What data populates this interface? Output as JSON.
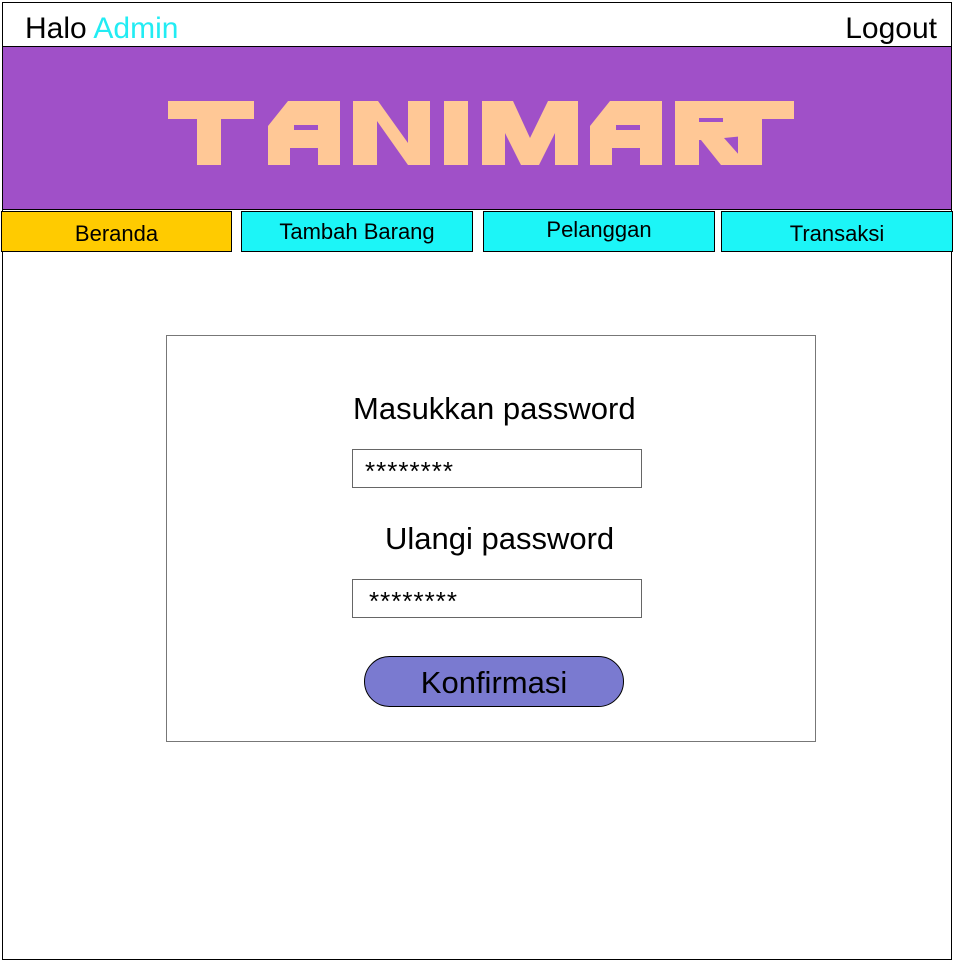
{
  "header": {
    "greeting": "Halo",
    "user_name": "Admin",
    "logout_label": "Logout"
  },
  "brand": {
    "logo_text": "TANIMART",
    "banner_color": "#a050c8",
    "logo_color": "#ffc896"
  },
  "nav": {
    "tabs": [
      {
        "label": "Beranda",
        "active": true,
        "color": "#ffcb00"
      },
      {
        "label": "Tambah Barang",
        "active": false,
        "color": "#1cf5f7"
      },
      {
        "label": "Pelanggan",
        "active": false,
        "color": "#1cf5f7"
      },
      {
        "label": "Transaksi",
        "active": false,
        "color": "#1cf5f7"
      }
    ]
  },
  "form": {
    "password_label": "Masukkan password",
    "password_value": "********",
    "repeat_label": "Ulangi password",
    "repeat_value": "********",
    "submit_label": "Konfirmasi",
    "submit_color": "#7a7ad0"
  }
}
